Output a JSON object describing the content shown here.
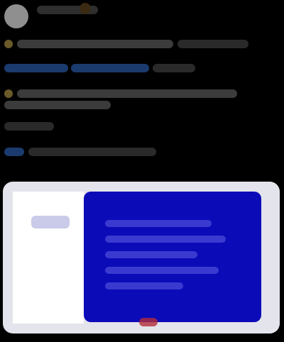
{
  "post": {
    "author": "",
    "text_lines": [],
    "image": {
      "colors": {
        "left_panel": "#ffffff",
        "right_panel": "#0b0bb8",
        "frame": "#e4e4ec"
      }
    }
  },
  "colors": {
    "background": "#000000",
    "link": "#1d9bf0"
  }
}
